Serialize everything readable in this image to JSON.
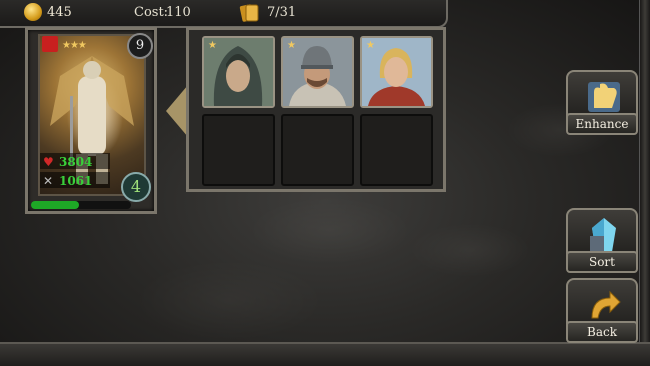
{
  "topbar": {
    "coins": "445",
    "cost_label": "Cost:",
    "cost_value": "110",
    "cards_count": "7/31"
  },
  "hero_card": {
    "level": "9",
    "stars": "★★★",
    "hp": "3804",
    "attack": "1061",
    "cost": "4",
    "xp_fraction": 0.48
  },
  "deck_slots": [
    {
      "filled": true,
      "stars": "★",
      "portrait": "hooded-woman"
    },
    {
      "filled": true,
      "stars": "★",
      "portrait": "helmeted-soldier"
    },
    {
      "filled": true,
      "stars": "★",
      "portrait": "young-woman"
    },
    {
      "filled": false
    },
    {
      "filled": false
    },
    {
      "filled": false
    }
  ],
  "buttons": {
    "enhance": "Enhance",
    "sort": "Sort",
    "back": "Back"
  },
  "colors": {
    "hp_text": "#39d03a",
    "star": "#f0c860",
    "panel_border": "#7b766b"
  }
}
